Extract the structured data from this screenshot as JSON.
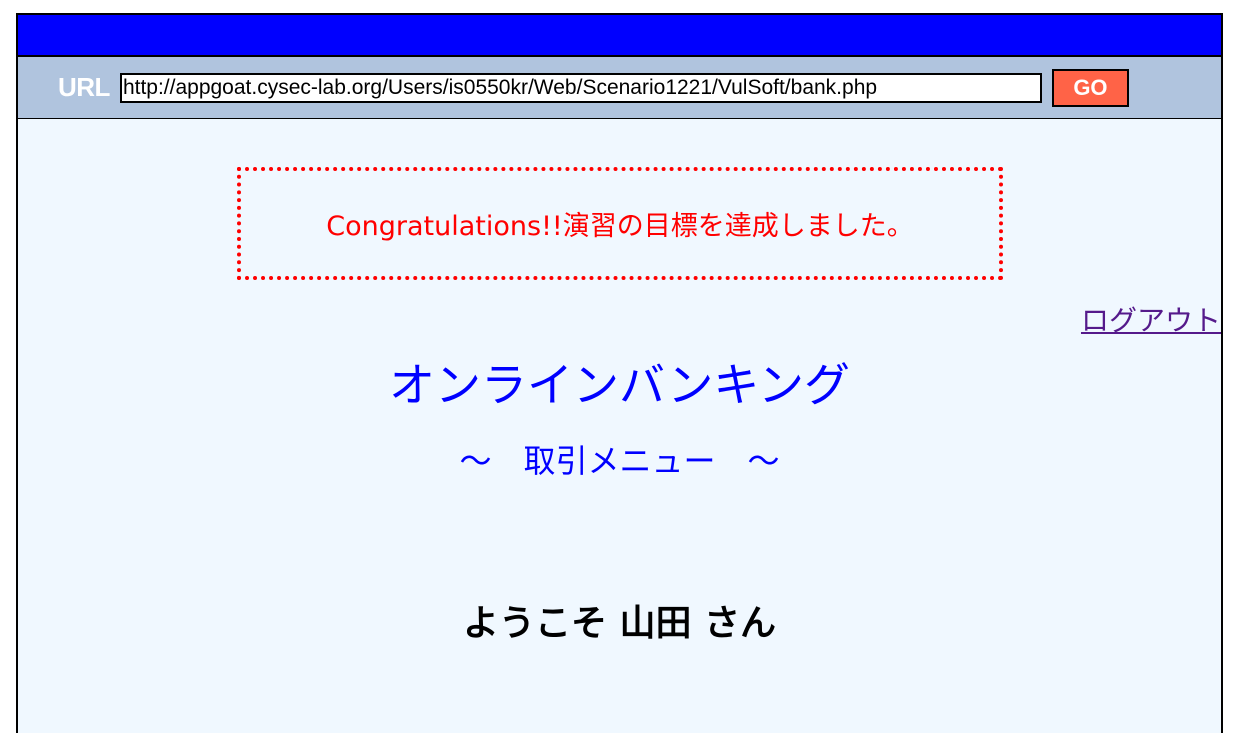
{
  "urlbar": {
    "label": "URL",
    "url": "http://appgoat.cysec-lab.org/Users/is0550kr/Web/Scenario1221/VulSoft/bank.php",
    "go_label": "GO"
  },
  "notice": {
    "message": "Congratulations!!演習の目標を達成しました。"
  },
  "header": {
    "logout_label": "ログアウト",
    "title": "オンラインバンキング",
    "subtitle": "～　取引メニュー　～"
  },
  "main": {
    "welcome": "ようこそ 山田 さん"
  },
  "colors": {
    "titlebar": "#0000ff",
    "urlbar": "#b0c4de",
    "go_button": "#ff6347",
    "notice_border": "#ff0000",
    "page_background": "#f0f8ff",
    "title_text": "#0000ff"
  }
}
